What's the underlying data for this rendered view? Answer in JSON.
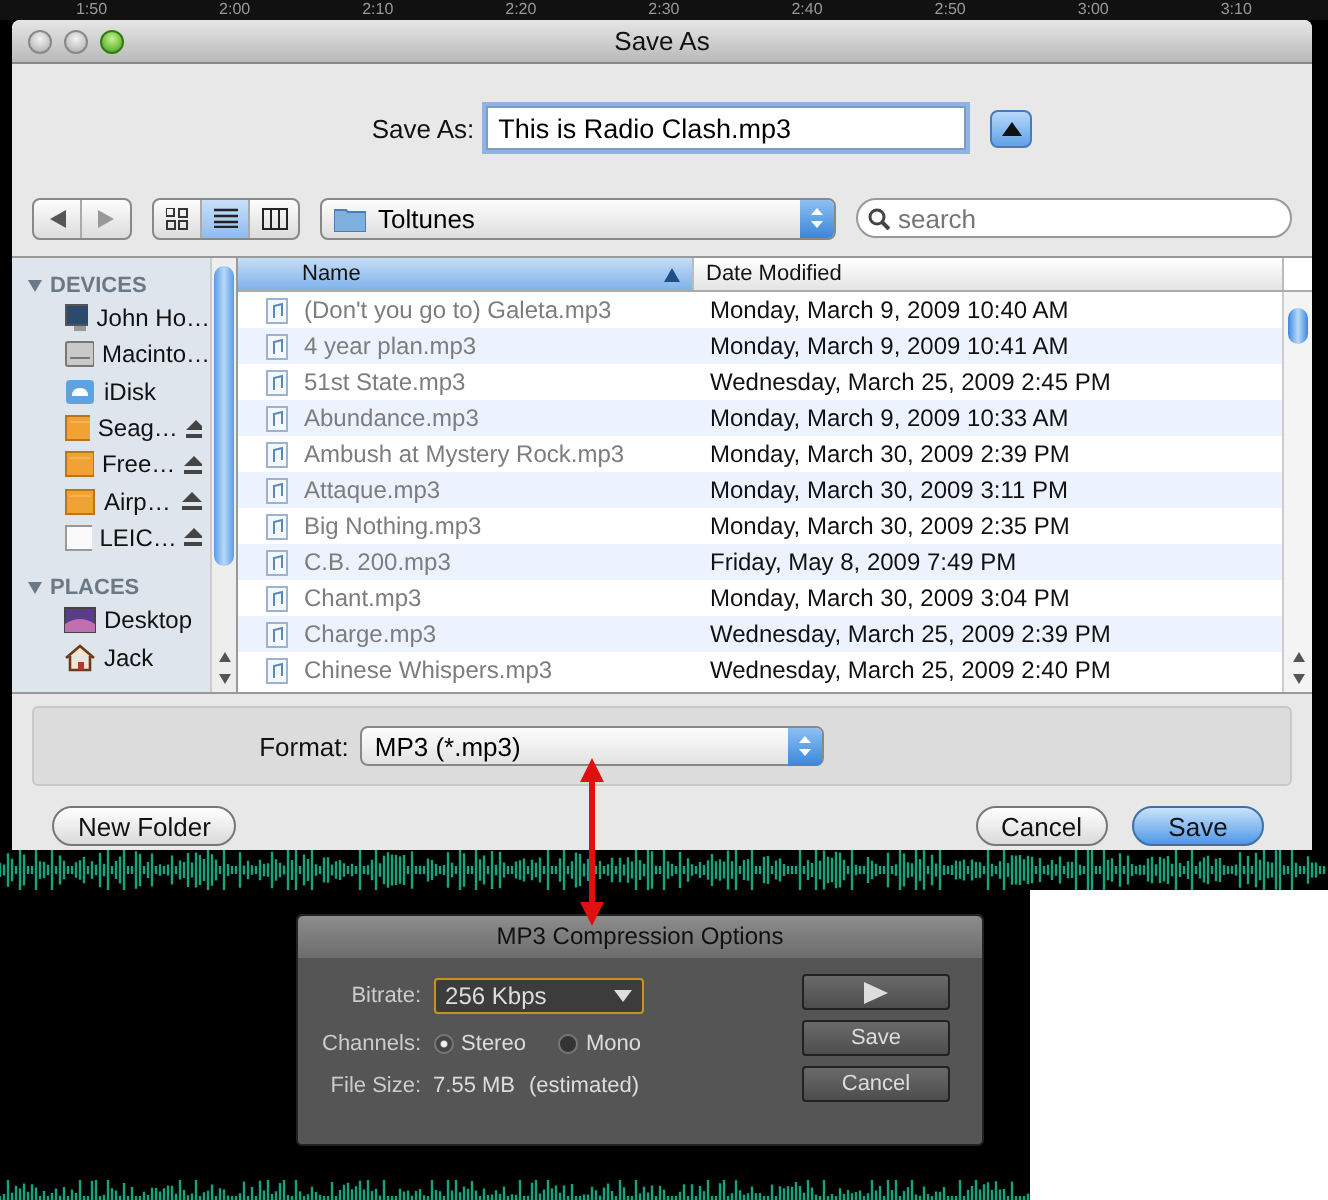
{
  "ruler": {
    "labels": [
      "1:50",
      "2:00",
      "2:10",
      "2:20",
      "2:30",
      "2:40",
      "2:50",
      "3:00",
      "3:10"
    ]
  },
  "save_dialog": {
    "title": "Save As",
    "save_as": {
      "label": "Save As:",
      "value": "This is Radio Clash.mp3"
    },
    "view_buttons": [
      {
        "kind": "icon",
        "selected": false
      },
      {
        "kind": "list",
        "selected": true
      },
      {
        "kind": "column",
        "selected": false
      }
    ],
    "folder": "Toltunes",
    "search": {
      "placeholder": "search"
    },
    "sidebar": [
      {
        "label": "DEVICES",
        "expanded": true,
        "items": [
          {
            "label": "John Ho…",
            "kind": "computer",
            "eject": false
          },
          {
            "label": "Macinto…",
            "kind": "drive",
            "eject": false
          },
          {
            "label": "iDisk",
            "kind": "idisk",
            "eject": false
          },
          {
            "label": "Seag…",
            "kind": "external",
            "eject": true
          },
          {
            "label": "Free…",
            "kind": "external",
            "eject": true
          },
          {
            "label": "Airp…",
            "kind": "external",
            "eject": true
          },
          {
            "label": "LEIC…",
            "kind": "disk",
            "eject": true
          }
        ]
      },
      {
        "label": "PLACES",
        "expanded": true,
        "items": [
          {
            "label": "Desktop",
            "kind": "desktop",
            "eject": false
          },
          {
            "label": "Jack",
            "kind": "home",
            "eject": false
          }
        ]
      }
    ],
    "columns": [
      {
        "label": "Name",
        "sorted": true
      },
      {
        "label": "Date Modified",
        "sorted": false
      }
    ],
    "rows": [
      {
        "name": "(Don't you go to) Galeta.mp3",
        "date": "Monday, March 9, 2009 10:40 AM",
        "disabled": true
      },
      {
        "name": "4 year plan.mp3",
        "date": "Monday, March 9, 2009 10:41 AM",
        "disabled": true
      },
      {
        "name": "51st State.mp3",
        "date": "Wednesday, March 25, 2009 2:45 PM",
        "disabled": true
      },
      {
        "name": "Abundance.mp3",
        "date": "Monday, March 9, 2009 10:33 AM",
        "disabled": true
      },
      {
        "name": "Ambush at Mystery Rock.mp3",
        "date": "Monday, March 30, 2009 2:39 PM",
        "disabled": true
      },
      {
        "name": "Attaque.mp3",
        "date": "Monday, March 30, 2009 3:11 PM",
        "disabled": true
      },
      {
        "name": "Big Nothing.mp3",
        "date": "Monday, March 30, 2009 2:35 PM",
        "disabled": true
      },
      {
        "name": "C.B. 200.mp3",
        "date": "Friday, May 8, 2009 7:49 PM",
        "disabled": true
      },
      {
        "name": "Chant.mp3",
        "date": "Monday, March 30, 2009 3:04 PM",
        "disabled": true
      },
      {
        "name": "Charge.mp3",
        "date": "Wednesday, March 25, 2009 2:39 PM",
        "disabled": true
      },
      {
        "name": "Chinese Whispers.mp3",
        "date": "Wednesday, March 25, 2009 2:40 PM",
        "disabled": true
      }
    ],
    "format": {
      "label": "Format:",
      "value": "MP3 (*.mp3)"
    },
    "buttons": [
      {
        "label": "New Folder",
        "default": false
      },
      {
        "label": "Cancel",
        "default": false
      },
      {
        "label": "Save",
        "default": true
      }
    ]
  },
  "compression_dialog": {
    "title": "MP3 Compression Options",
    "bitrate": {
      "label": "Bitrate:",
      "value": "256 Kbps"
    },
    "channels": {
      "label": "Channels:",
      "options": [
        {
          "label": "Stereo",
          "selected": true
        },
        {
          "label": "Mono",
          "selected": false
        }
      ]
    },
    "file_size": {
      "label": "File Size:",
      "value": "7.55 MB",
      "note": "(estimated)"
    },
    "buttons": [
      {
        "kind": "play"
      },
      {
        "kind": "text",
        "label": "Save"
      },
      {
        "kind": "text",
        "label": "Cancel"
      }
    ]
  }
}
